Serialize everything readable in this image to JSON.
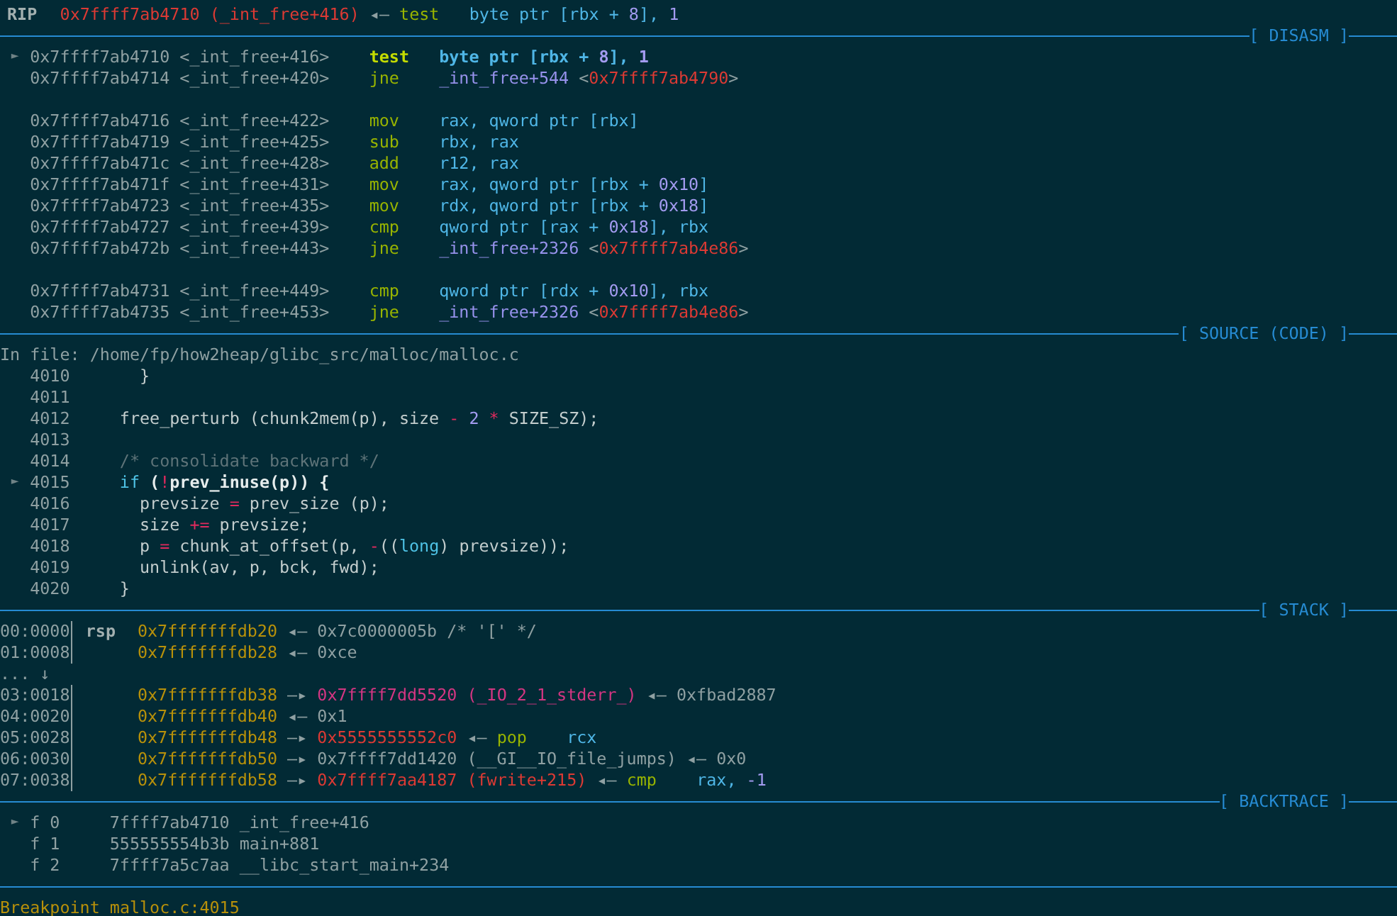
{
  "rip_line": {
    "register": "RIP",
    "segments": [
      {
        "kind": "code",
        "text": "0x7ffff7ab4710 (_int_free+416)"
      },
      {
        "kind": "text",
        "text": " ◂— "
      },
      {
        "kind": "op",
        "text": "test"
      },
      {
        "kind": "opnd",
        "text": "   byte ptr [rbx + "
      },
      {
        "kind": "num",
        "text": "8"
      },
      {
        "kind": "opnd",
        "text": "], "
      },
      {
        "kind": "num",
        "text": "1"
      }
    ]
  },
  "panes": [
    {
      "title": "[ DISASM ]",
      "lines": [
        {
          "kind": "asm",
          "current": true,
          "marker": "►",
          "address": "0x7ffff7ab4710",
          "symbol": "<_int_free+416>",
          "mnemonic": "test",
          "operands": [
            {
              "kind": "opnd",
              "text": "byte ptr [rbx + "
            },
            {
              "kind": "num",
              "text": "8"
            },
            {
              "kind": "opnd",
              "text": "], "
            },
            {
              "kind": "num",
              "text": "1"
            }
          ]
        },
        {
          "kind": "asm",
          "current": false,
          "address": "0x7ffff7ab4714",
          "symbol": "<_int_free+420>",
          "mnemonic": "jne",
          "operands": [
            {
              "kind": "sym",
              "text": "_int_free+544 "
            },
            {
              "kind": "text",
              "text": "<"
            },
            {
              "kind": "code",
              "text": "0x7ffff7ab4790"
            },
            {
              "kind": "text",
              "text": ">"
            }
          ]
        },
        {
          "kind": "blank"
        },
        {
          "kind": "asm",
          "current": false,
          "address": "0x7ffff7ab4716",
          "symbol": "<_int_free+422>",
          "mnemonic": "mov",
          "operands": [
            {
              "kind": "opnd",
              "text": "rax, qword ptr [rbx]"
            }
          ]
        },
        {
          "kind": "asm",
          "current": false,
          "address": "0x7ffff7ab4719",
          "symbol": "<_int_free+425>",
          "mnemonic": "sub",
          "operands": [
            {
              "kind": "opnd",
              "text": "rbx, rax"
            }
          ]
        },
        {
          "kind": "asm",
          "current": false,
          "address": "0x7ffff7ab471c",
          "symbol": "<_int_free+428>",
          "mnemonic": "add",
          "operands": [
            {
              "kind": "opnd",
              "text": "r12, rax"
            }
          ]
        },
        {
          "kind": "asm",
          "current": false,
          "address": "0x7ffff7ab471f",
          "symbol": "<_int_free+431>",
          "mnemonic": "mov",
          "operands": [
            {
              "kind": "opnd",
              "text": "rax, qword ptr [rbx + "
            },
            {
              "kind": "num",
              "text": "0x10"
            },
            {
              "kind": "opnd",
              "text": "]"
            }
          ]
        },
        {
          "kind": "asm",
          "current": false,
          "address": "0x7ffff7ab4723",
          "symbol": "<_int_free+435>",
          "mnemonic": "mov",
          "operands": [
            {
              "kind": "opnd",
              "text": "rdx, qword ptr [rbx + "
            },
            {
              "kind": "num",
              "text": "0x18"
            },
            {
              "kind": "opnd",
              "text": "]"
            }
          ]
        },
        {
          "kind": "asm",
          "current": false,
          "address": "0x7ffff7ab4727",
          "symbol": "<_int_free+439>",
          "mnemonic": "cmp",
          "operands": [
            {
              "kind": "opnd",
              "text": "qword ptr [rax + "
            },
            {
              "kind": "num",
              "text": "0x18"
            },
            {
              "kind": "opnd",
              "text": "], rbx"
            }
          ]
        },
        {
          "kind": "asm",
          "current": false,
          "address": "0x7ffff7ab472b",
          "symbol": "<_int_free+443>",
          "mnemonic": "jne",
          "operands": [
            {
              "kind": "sym",
              "text": "_int_free+2326 "
            },
            {
              "kind": "text",
              "text": "<"
            },
            {
              "kind": "code",
              "text": "0x7ffff7ab4e86"
            },
            {
              "kind": "text",
              "text": ">"
            }
          ]
        },
        {
          "kind": "blank"
        },
        {
          "kind": "asm",
          "current": false,
          "address": "0x7ffff7ab4731",
          "symbol": "<_int_free+449>",
          "mnemonic": "cmp",
          "operands": [
            {
              "kind": "opnd",
              "text": "qword ptr [rdx + "
            },
            {
              "kind": "num",
              "text": "0x10"
            },
            {
              "kind": "opnd",
              "text": "], rbx"
            }
          ]
        },
        {
          "kind": "asm",
          "current": false,
          "address": "0x7ffff7ab4735",
          "symbol": "<_int_free+453>",
          "mnemonic": "jne",
          "operands": [
            {
              "kind": "sym",
              "text": "_int_free+2326 "
            },
            {
              "kind": "text",
              "text": "<"
            },
            {
              "kind": "code",
              "text": "0x7ffff7ab4e86"
            },
            {
              "kind": "text",
              "text": ">"
            }
          ]
        }
      ]
    },
    {
      "title": "[ SOURCE (CODE) ]",
      "lines": [
        {
          "kind": "flush",
          "segments": [
            {
              "kind": "text",
              "text": "In file: /home/fp/how2heap/glibc_src/malloc/malloc.c"
            }
          ]
        },
        {
          "kind": "src",
          "number": "4010",
          "code": [
            {
              "kind": "bright",
              "text": "  }"
            }
          ]
        },
        {
          "kind": "src",
          "number": "4011"
        },
        {
          "kind": "src",
          "number": "4012",
          "code": [
            {
              "kind": "bright",
              "text": "free_perturb (chunk2mem(p), size "
            },
            {
              "kind": "opchar",
              "text": "-"
            },
            {
              "kind": "num",
              "text": " 2"
            },
            {
              "kind": "opchar",
              "text": " *"
            },
            {
              "kind": "bright",
              "text": " SIZE_SZ);"
            }
          ]
        },
        {
          "kind": "src",
          "number": "4013"
        },
        {
          "kind": "src",
          "number": "4014",
          "code": [
            {
              "kind": "comment",
              "text": "/* consolidate backward */"
            }
          ]
        },
        {
          "kind": "src",
          "marker": "►",
          "number": "4015",
          "code": [
            {
              "kind": "kw",
              "text": "if"
            },
            {
              "kind": "strong",
              "text": " ("
            },
            {
              "kind": "opchar",
              "text": "!"
            },
            {
              "kind": "strong",
              "text": "prev_inuse(p)) {"
            }
          ]
        },
        {
          "kind": "src",
          "number": "4016",
          "code": [
            {
              "kind": "bright",
              "text": "  prevsize "
            },
            {
              "kind": "opchar",
              "text": "="
            },
            {
              "kind": "bright",
              "text": " prev_size (p);"
            }
          ]
        },
        {
          "kind": "src",
          "number": "4017",
          "code": [
            {
              "kind": "bright",
              "text": "  size "
            },
            {
              "kind": "opchar",
              "text": "+="
            },
            {
              "kind": "bright",
              "text": " prevsize;"
            }
          ]
        },
        {
          "kind": "src",
          "number": "4018",
          "code": [
            {
              "kind": "bright",
              "text": "  p "
            },
            {
              "kind": "opchar",
              "text": "="
            },
            {
              "kind": "bright",
              "text": " chunk_at_offset(p, "
            },
            {
              "kind": "opchar",
              "text": "-"
            },
            {
              "kind": "bright",
              "text": "(("
            },
            {
              "kind": "kw",
              "text": "long"
            },
            {
              "kind": "bright",
              "text": ") prevsize));"
            }
          ]
        },
        {
          "kind": "src",
          "number": "4019",
          "code": [
            {
              "kind": "bright",
              "text": "  unlink(av, p, bck, fwd);"
            }
          ]
        },
        {
          "kind": "src",
          "number": "4020",
          "code": [
            {
              "kind": "bright",
              "text": "}"
            }
          ]
        }
      ]
    },
    {
      "title": "[ STACK ]",
      "lines": [
        {
          "kind": "stack",
          "offset": "00:0000",
          "register": "rsp",
          "segments": [
            {
              "kind": "stack",
              "text": "0x7fffffffdb20"
            },
            {
              "kind": "text",
              "text": " ◂— 0x7c0000005b /* '[' */"
            }
          ]
        },
        {
          "kind": "stack",
          "offset": "01:0008",
          "segments": [
            {
              "kind": "stack",
              "text": "0x7fffffffdb28"
            },
            {
              "kind": "text",
              "text": " ◂— 0xce"
            }
          ]
        },
        {
          "kind": "flush",
          "segments": [
            {
              "kind": "text",
              "text": "... ↓"
            }
          ]
        },
        {
          "kind": "stack",
          "offset": "03:0018",
          "segments": [
            {
              "kind": "stack",
              "text": "0x7fffffffdb38"
            },
            {
              "kind": "text",
              "text": " —▸ "
            },
            {
              "kind": "data",
              "text": "0x7ffff7dd5520 (_IO_2_1_stderr_)"
            },
            {
              "kind": "text",
              "text": " ◂— 0xfbad2887"
            }
          ]
        },
        {
          "kind": "stack",
          "offset": "04:0020",
          "segments": [
            {
              "kind": "stack",
              "text": "0x7fffffffdb40"
            },
            {
              "kind": "text",
              "text": " ◂— 0x1"
            }
          ]
        },
        {
          "kind": "stack",
          "offset": "05:0028",
          "segments": [
            {
              "kind": "stack",
              "text": "0x7fffffffdb48"
            },
            {
              "kind": "text",
              "text": " —▸ "
            },
            {
              "kind": "code",
              "text": "0x5555555552c0"
            },
            {
              "kind": "text",
              "text": " ◂— "
            },
            {
              "kind": "op",
              "text": "pop"
            },
            {
              "kind": "opnd",
              "text": "    rcx"
            }
          ]
        },
        {
          "kind": "stack",
          "offset": "06:0030",
          "segments": [
            {
              "kind": "stack",
              "text": "0x7fffffffdb50"
            },
            {
              "kind": "text",
              "text": " —▸ 0x7ffff7dd1420 (__GI__IO_file_jumps) ◂— 0x0"
            }
          ]
        },
        {
          "kind": "stack",
          "offset": "07:0038",
          "segments": [
            {
              "kind": "stack",
              "text": "0x7fffffffdb58"
            },
            {
              "kind": "text",
              "text": " —▸ "
            },
            {
              "kind": "code",
              "text": "0x7ffff7aa4187 (fwrite+215)"
            },
            {
              "kind": "text",
              "text": " ◂— "
            },
            {
              "kind": "op",
              "text": "cmp"
            },
            {
              "kind": "opnd",
              "text": "    rax, "
            },
            {
              "kind": "num",
              "text": "-1"
            }
          ]
        }
      ]
    },
    {
      "title": "[ BACKTRACE ]",
      "lines": [
        {
          "kind": "frame",
          "marker": "►",
          "frame": "f 0",
          "address": "7ffff7ab4710",
          "symbol": "_int_free+416"
        },
        {
          "kind": "frame",
          "frame": "f 1",
          "address": "555555554b3b",
          "symbol": "main+881"
        },
        {
          "kind": "frame",
          "frame": "f 2",
          "address": "7ffff7a5c7aa",
          "symbol": "__libc_start_main+234"
        }
      ]
    },
    {
      "lines": [
        {
          "kind": "flush",
          "segments": [
            {
              "kind": "notice",
              "text": "Breakpoint malloc.c:4015"
            }
          ]
        }
      ]
    }
  ]
}
